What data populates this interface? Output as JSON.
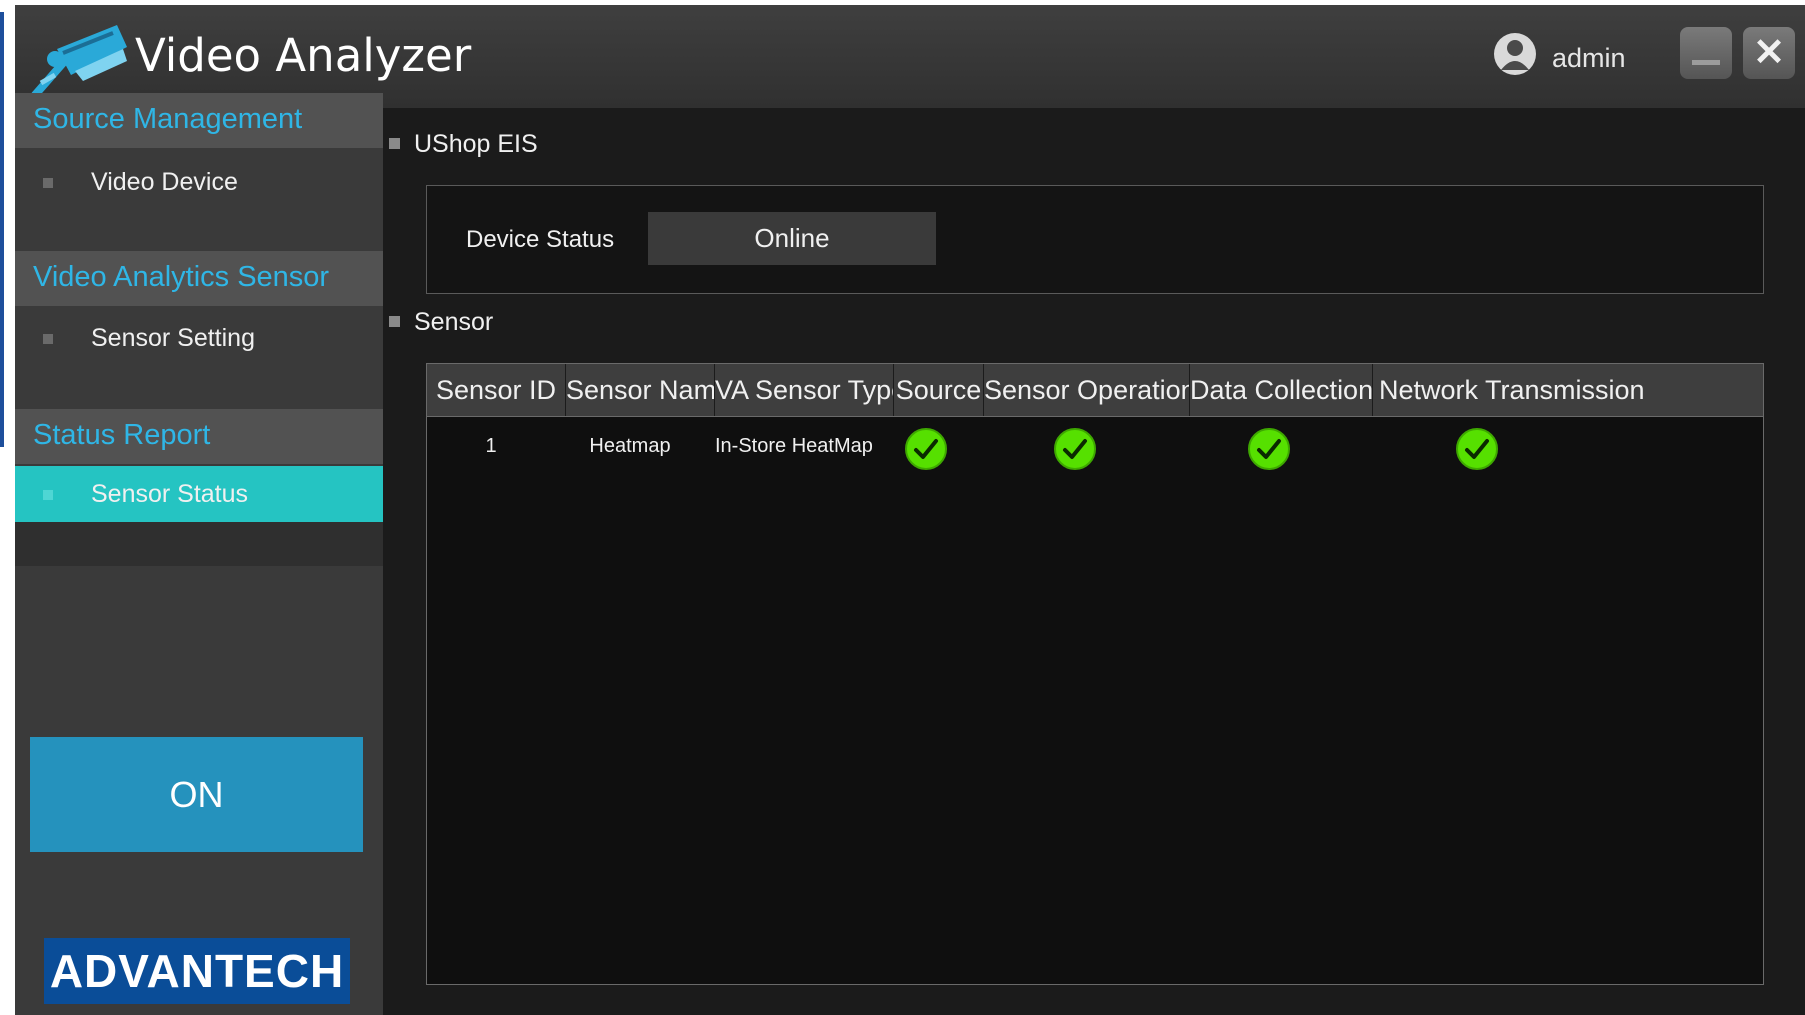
{
  "app": {
    "title": "Video Analyzer",
    "user": "admin",
    "logo_icon": "camera-icon",
    "brand": "ADVANTECH",
    "power_button": "ON"
  },
  "sidebar": {
    "sections": [
      {
        "title": "Source Management",
        "items": [
          {
            "label": "Video Device",
            "active": false
          }
        ]
      },
      {
        "title": "Video Analytics Sensor",
        "items": [
          {
            "label": "Sensor Setting",
            "active": false
          }
        ]
      },
      {
        "title": "Status Report",
        "items": [
          {
            "label": "Sensor Status",
            "active": true
          }
        ]
      }
    ]
  },
  "main": {
    "device_section": {
      "title": "UShop EIS",
      "status_label": "Device Status",
      "status_value": "Online"
    },
    "sensor_section": {
      "title": "Sensor",
      "columns": [
        "Sensor ID",
        "Sensor Name",
        "VA Sensor Type",
        "Source",
        "Sensor Operation",
        "Data Collection",
        "Network Transmission"
      ],
      "rows": [
        {
          "id": "1",
          "name": "Heatmap",
          "type": "In-Store HeatMap",
          "source": "ok",
          "operation": "ok",
          "collection": "ok",
          "transmission": "ok"
        }
      ]
    }
  },
  "colors": {
    "accent_blue": "#2fb6e6",
    "active_teal": "#25c4c2",
    "on_button": "#2592bd",
    "status_ok": "#56e000",
    "brand_blue": "#0a4d98"
  }
}
